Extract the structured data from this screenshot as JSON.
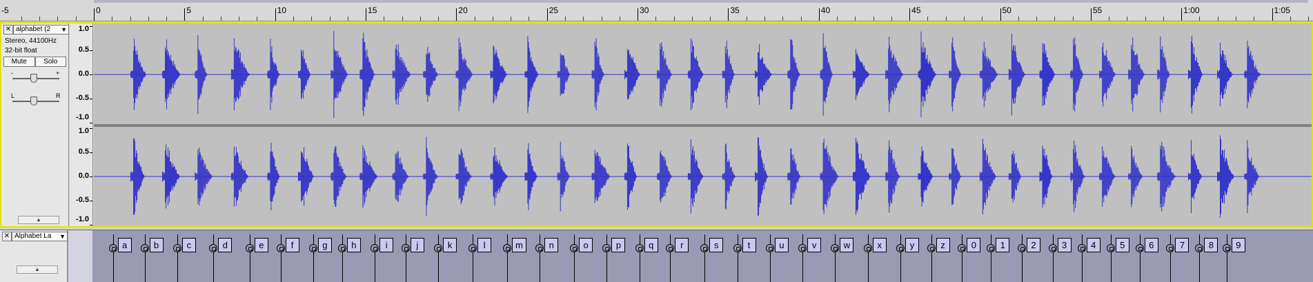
{
  "ruler": {
    "neg_label": "-5",
    "marks": [
      {
        "t": 0,
        "label": "0"
      },
      {
        "t": 5,
        "label": "5"
      },
      {
        "t": 10,
        "label": "10"
      },
      {
        "t": 15,
        "label": "15"
      },
      {
        "t": 20,
        "label": "20"
      },
      {
        "t": 25,
        "label": "25"
      },
      {
        "t": 30,
        "label": "30"
      },
      {
        "t": 35,
        "label": "35"
      },
      {
        "t": 40,
        "label": "40"
      },
      {
        "t": 45,
        "label": "45"
      },
      {
        "t": 50,
        "label": "50"
      },
      {
        "t": 55,
        "label": "55"
      },
      {
        "t": 60,
        "label": "1:00"
      },
      {
        "t": 65,
        "label": "1:05"
      }
    ]
  },
  "audio_track": {
    "close_label": "✕",
    "name": "alphabet (2",
    "dropdown_arrow": "▼",
    "format": "Stereo, 44100Hz",
    "bit_depth": "32-bit float",
    "mute_label": "Mute",
    "solo_label": "Solo",
    "gain_minus": "-",
    "gain_plus": "+",
    "gain_level": 0.45,
    "pan_left": "L",
    "pan_right": "R",
    "pan_level": 0.45,
    "collapse_arrow": "▲",
    "scale_labels": [
      "1.0",
      "0.5",
      "0.0",
      "-0.5",
      "-1.0"
    ],
    "waveform_color": "#3232c8",
    "clip_color": "#c0c0c0"
  },
  "label_track": {
    "close_label": "✕",
    "name": "Alphabet La",
    "dropdown_arrow": "▼",
    "collapse_arrow": "▲",
    "labels": [
      {
        "t": 1.05,
        "text": "a"
      },
      {
        "t": 2.8,
        "text": "b"
      },
      {
        "t": 4.6,
        "text": "c"
      },
      {
        "t": 6.6,
        "text": "d"
      },
      {
        "t": 8.6,
        "text": "e"
      },
      {
        "t": 10.3,
        "text": "f"
      },
      {
        "t": 12.1,
        "text": "g"
      },
      {
        "t": 13.7,
        "text": "h"
      },
      {
        "t": 15.5,
        "text": "i"
      },
      {
        "t": 17.2,
        "text": "j"
      },
      {
        "t": 19.0,
        "text": "k"
      },
      {
        "t": 20.9,
        "text": "l"
      },
      {
        "t": 22.8,
        "text": "m"
      },
      {
        "t": 24.6,
        "text": "n"
      },
      {
        "t": 26.5,
        "text": "o"
      },
      {
        "t": 28.3,
        "text": "p"
      },
      {
        "t": 30.1,
        "text": "q"
      },
      {
        "t": 31.8,
        "text": "r"
      },
      {
        "t": 33.7,
        "text": "s"
      },
      {
        "t": 35.5,
        "text": "t"
      },
      {
        "t": 37.3,
        "text": "u"
      },
      {
        "t": 39.1,
        "text": "v"
      },
      {
        "t": 40.9,
        "text": "w"
      },
      {
        "t": 42.7,
        "text": "x"
      },
      {
        "t": 44.5,
        "text": "y"
      },
      {
        "t": 46.2,
        "text": "z"
      },
      {
        "t": 47.9,
        "text": "0"
      },
      {
        "t": 49.5,
        "text": "1"
      },
      {
        "t": 51.2,
        "text": "2"
      },
      {
        "t": 52.9,
        "text": "3"
      },
      {
        "t": 54.5,
        "text": "4"
      },
      {
        "t": 56.1,
        "text": "5"
      },
      {
        "t": 57.7,
        "text": "6"
      },
      {
        "t": 59.4,
        "text": "7"
      },
      {
        "t": 61.0,
        "text": "8"
      },
      {
        "t": 62.5,
        "text": "9"
      }
    ]
  }
}
